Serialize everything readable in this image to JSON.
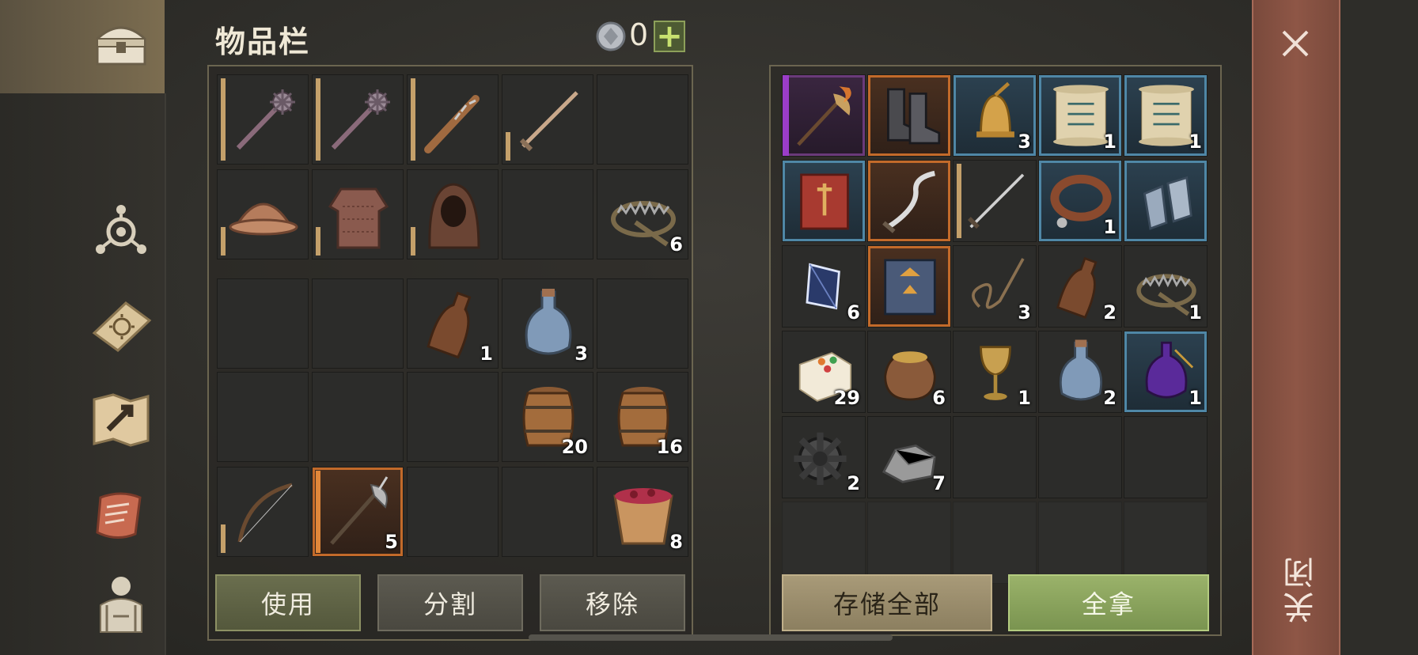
{
  "inventory": {
    "title": "物品栏",
    "currency_count": "0",
    "add_label": "+"
  },
  "inv_equipment_rows": [
    [
      {
        "icon": "mace-icon",
        "count": "",
        "bar": "full"
      },
      {
        "icon": "mace-icon",
        "count": "",
        "bar": "full"
      },
      {
        "icon": "spiked-club-icon",
        "count": "",
        "bar": "full"
      },
      {
        "icon": "sword-icon",
        "count": "",
        "bar": "partial"
      },
      {
        "icon": "",
        "count": "",
        "bar": ""
      }
    ],
    [
      {
        "icon": "helmet-icon",
        "count": "",
        "bar": "partial"
      },
      {
        "icon": "chainmail-icon",
        "count": "",
        "bar": "partial"
      },
      {
        "icon": "hood-icon",
        "count": "",
        "bar": "partial"
      },
      {
        "icon": "",
        "count": "",
        "bar": ""
      },
      {
        "icon": "bear-trap-icon",
        "count": "6",
        "bar": ""
      }
    ]
  ],
  "inv_bag_rows": [
    [
      {
        "icon": "",
        "count": ""
      },
      {
        "icon": "",
        "count": ""
      },
      {
        "icon": "bottle-icon",
        "count": "1"
      },
      {
        "icon": "potion-flask-icon",
        "count": "3"
      },
      {
        "icon": "",
        "count": ""
      }
    ],
    [
      {
        "icon": "",
        "count": ""
      },
      {
        "icon": "",
        "count": ""
      },
      {
        "icon": "",
        "count": ""
      },
      {
        "icon": "barrel-icon",
        "count": "20"
      },
      {
        "icon": "barrel-icon",
        "count": "16"
      }
    ],
    [
      {
        "icon": "bow-icon",
        "count": "",
        "bar": "partial"
      },
      {
        "icon": "halberd-icon",
        "count": "5",
        "quality": "orange",
        "bar": "orange"
      },
      {
        "icon": "",
        "count": ""
      },
      {
        "icon": "",
        "count": ""
      },
      {
        "icon": "berry-bucket-icon",
        "count": "8"
      }
    ]
  ],
  "storage_rows": [
    [
      {
        "icon": "flaming-axe-icon",
        "count": "",
        "quality": "purple"
      },
      {
        "icon": "boots-icon",
        "count": "",
        "quality": "orange"
      },
      {
        "icon": "bell-icon",
        "count": "3",
        "quality": "blue"
      },
      {
        "icon": "scroll-icon",
        "count": "1",
        "quality": "blue"
      },
      {
        "icon": "scroll-icon",
        "count": "1",
        "quality": "blue"
      }
    ],
    [
      {
        "icon": "red-book-icon",
        "count": "",
        "quality": "blue"
      },
      {
        "icon": "curved-blade-icon",
        "count": "",
        "quality": "orange"
      },
      {
        "icon": "longsword-icon",
        "count": "",
        "quality": "bar"
      },
      {
        "icon": "collar-icon",
        "count": "1",
        "quality": "blue"
      },
      {
        "icon": "gauntlets-icon",
        "count": "",
        "quality": "blue"
      }
    ],
    [
      {
        "icon": "crystal-icon",
        "count": "6",
        "quality": ""
      },
      {
        "icon": "blue-book-icon",
        "count": "",
        "quality": "orange"
      },
      {
        "icon": "rope-icon",
        "count": "3",
        "quality": ""
      },
      {
        "icon": "bottle-icon",
        "count": "2",
        "quality": ""
      },
      {
        "icon": "bear-trap-icon",
        "count": "1",
        "quality": ""
      }
    ],
    [
      {
        "icon": "cake-icon",
        "count": "29",
        "quality": ""
      },
      {
        "icon": "grain-sack-icon",
        "count": "6",
        "quality": ""
      },
      {
        "icon": "goblet-icon",
        "count": "1",
        "quality": ""
      },
      {
        "icon": "potion-flask-icon",
        "count": "2",
        "quality": ""
      },
      {
        "icon": "purple-potion-icon",
        "count": "1",
        "quality": "blue"
      }
    ],
    [
      {
        "icon": "gear-part-icon",
        "count": "2",
        "quality": ""
      },
      {
        "icon": "stone-ore-icon",
        "count": "7",
        "quality": ""
      },
      {
        "icon": "",
        "count": "",
        "quality": ""
      },
      {
        "icon": "",
        "count": "",
        "quality": ""
      },
      {
        "icon": "",
        "count": "",
        "quality": ""
      }
    ],
    [
      {
        "icon": "",
        "count": "",
        "quality": "faded"
      },
      {
        "icon": "",
        "count": "",
        "quality": "faded"
      },
      {
        "icon": "",
        "count": "",
        "quality": "faded"
      },
      {
        "icon": "",
        "count": "",
        "quality": "faded"
      },
      {
        "icon": "",
        "count": "",
        "quality": "faded"
      }
    ]
  ],
  "buttons": {
    "use": "使用",
    "split": "分割",
    "remove": "移除",
    "store_all": "存储全部",
    "take_all": "全拿",
    "close": "关闭"
  },
  "colors": {
    "quality_blue": "#4f87a6",
    "quality_orange": "#c26a2a",
    "quality_purple": "#9b3dc8",
    "durability_bar": "#c4a06a"
  }
}
